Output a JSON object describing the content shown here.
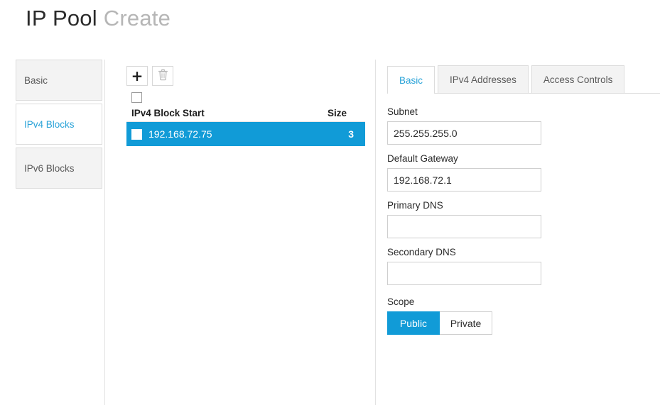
{
  "header": {
    "title_main": "IP Pool",
    "title_sub": "Create"
  },
  "colors": {
    "accent_blue": "#119bd7",
    "link_blue": "#2aa3d8",
    "panel_gray": "#f3f3f3",
    "border_gray": "#dcdcdc"
  },
  "wizard": {
    "steps": [
      {
        "label": "Basic",
        "active": false
      },
      {
        "label": "IPv4 Blocks",
        "active": true
      },
      {
        "label": "IPv6 Blocks",
        "active": false
      }
    ]
  },
  "blocks": {
    "toolbar": {
      "add_label": "+",
      "add_icon": "plus-icon",
      "delete_icon": "trash-icon",
      "delete_enabled": false
    },
    "select_all_checked": false,
    "columns": {
      "start": "IPv4 Block Start",
      "size": "Size"
    },
    "rows": [
      {
        "start": "192.168.72.75",
        "size": "3",
        "selected": true,
        "checked": false
      }
    ]
  },
  "detail": {
    "tabs": [
      {
        "label": "Basic",
        "active": true
      },
      {
        "label": "IPv4 Addresses",
        "active": false
      },
      {
        "label": "Access Controls",
        "active": false
      }
    ],
    "fields": {
      "subnet": {
        "label": "Subnet",
        "value": "255.255.255.0",
        "placeholder": ""
      },
      "gateway": {
        "label": "Default Gateway",
        "value": "192.168.72.1",
        "placeholder": ""
      },
      "primary_dns": {
        "label": "Primary DNS",
        "value": "",
        "placeholder": ""
      },
      "secondary_dns": {
        "label": "Secondary DNS",
        "value": "",
        "placeholder": ""
      }
    },
    "scope": {
      "label": "Scope",
      "options": [
        "Public",
        "Private"
      ],
      "selected": "Public"
    }
  }
}
